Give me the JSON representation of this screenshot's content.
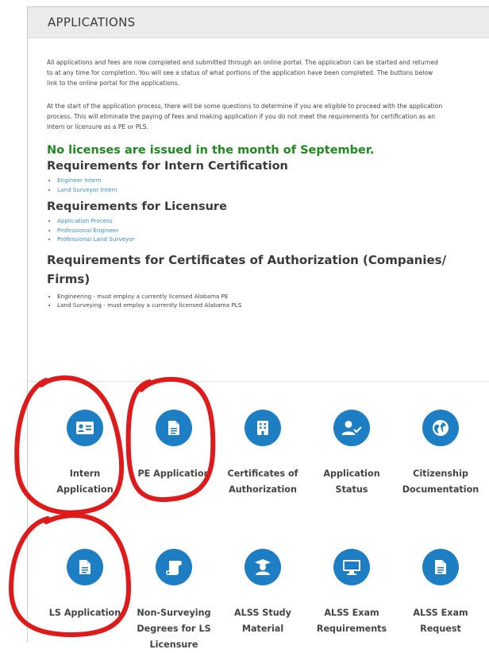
{
  "panel": {
    "title": "APPLICATIONS"
  },
  "intro": {
    "lines1": [
      "All applications and fees are now completed and submitted through an online portal. The application can be started and returned",
      "to at any time for completion. You will see a status of what portions of the application have been completed. The buttons below",
      "link to the online portal for the applications."
    ],
    "lines2": [
      "At the start of the application process, there will be some questions to determine if you are eligible to proceed with the application",
      "process. This will eliminate the paying of fees and making application if you do not meet the requirements for certification as an",
      "Intern or licensure as a PE or PLS."
    ]
  },
  "notice": "No licenses are issued in the month of September.",
  "intern_section": {
    "heading": "Requirements for Intern Certification",
    "links": [
      "Engineer Intern",
      "Land Surveyor Intern"
    ]
  },
  "licensure_section": {
    "heading": "Requirements for Licensure",
    "links": [
      "Application Process",
      "Professional Engineer",
      "Professional Land Surveyor"
    ]
  },
  "authorization_section": {
    "heading": "Requirements for Certificates of Authorization (Companies/ Firms)",
    "items": [
      "Engineering - must employ a currently licensed Alabama PE",
      "Land Surveying - must employ a currently licensed Alabama PLS"
    ]
  },
  "tiles": [
    {
      "label": "Intern Application",
      "icon": "id-card-icon"
    },
    {
      "label": "PE Application",
      "icon": "document-icon"
    },
    {
      "label": "Certificates of Authorization",
      "icon": "building-icon"
    },
    {
      "label": "Application Status",
      "icon": "user-check-icon"
    },
    {
      "label": "Citizenship Documentation",
      "icon": "globe-icon"
    },
    {
      "label": "LS Application",
      "icon": "document-icon"
    },
    {
      "label": "Non-Surveying Degrees for LS Licensure",
      "icon": "scroll-icon"
    },
    {
      "label": "ALSS Study Material",
      "icon": "graduate-icon"
    },
    {
      "label": "ALSS Exam Requirements",
      "icon": "monitor-icon"
    },
    {
      "label": "ALSS Exam Request",
      "icon": "document-icon"
    }
  ],
  "colors": {
    "icon_circle": "#1d7ec4",
    "notice_green": "#1f8a1f",
    "link_blue": "#3a8fd0",
    "annotation_red": "#e01a1a"
  }
}
